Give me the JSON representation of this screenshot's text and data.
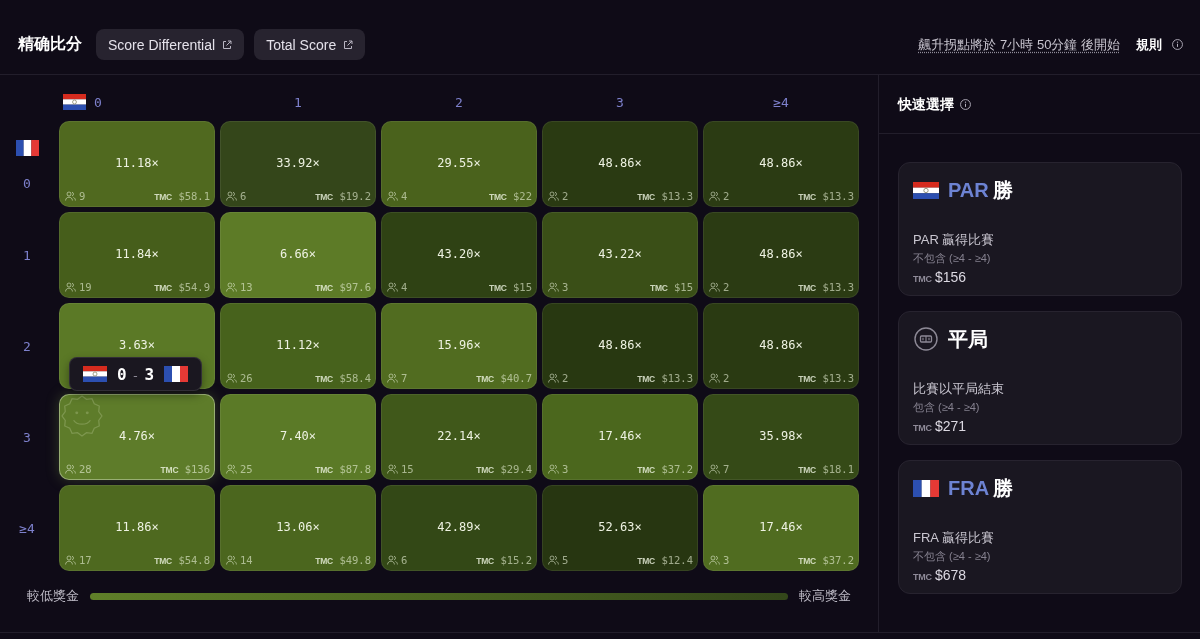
{
  "header": {
    "title": "精确比分",
    "links": [
      {
        "label": "Score Differential"
      },
      {
        "label": "Total Score"
      }
    ],
    "countdown": "飆升拐點將於 7小時 50分鐘 後開始",
    "rules": "規則"
  },
  "grid": {
    "columns": [
      "0",
      "1",
      "2",
      "3",
      "≥4"
    ],
    "rows": [
      {
        "label": "0",
        "cells": [
          {
            "multiplier": "11.18×",
            "players": "9",
            "token": "TMC",
            "amount": "$58.1",
            "color": "#50691f",
            "selected": false
          },
          {
            "multiplier": "33.92×",
            "players": "6",
            "token": "TMC",
            "amount": "$19.2",
            "color": "#34461a",
            "selected": false
          },
          {
            "multiplier": "29.55×",
            "players": "4",
            "token": "TMC",
            "amount": "$22",
            "color": "#4a621c",
            "selected": false
          },
          {
            "multiplier": "48.86×",
            "players": "2",
            "token": "TMC",
            "amount": "$13.3",
            "color": "#2a3a12",
            "selected": false
          },
          {
            "multiplier": "48.86×",
            "players": "2",
            "token": "TMC",
            "amount": "$13.3",
            "color": "#2b3b13",
            "selected": false
          }
        ]
      },
      {
        "label": "1",
        "cells": [
          {
            "multiplier": "11.84×",
            "players": "19",
            "token": "TMC",
            "amount": "$54.9",
            "color": "#465e1b",
            "selected": false
          },
          {
            "multiplier": "6.66×",
            "players": "13",
            "token": "TMC",
            "amount": "$97.6",
            "color": "#5d7b27",
            "selected": false
          },
          {
            "multiplier": "43.20×",
            "players": "4",
            "token": "TMC",
            "amount": "$15",
            "color": "#2f4214",
            "selected": false
          },
          {
            "multiplier": "43.22×",
            "players": "3",
            "token": "TMC",
            "amount": "$15",
            "color": "#3a4f17",
            "selected": false
          },
          {
            "multiplier": "48.86×",
            "players": "2",
            "token": "TMC",
            "amount": "$13.3",
            "color": "#2b3b13",
            "selected": false
          }
        ]
      },
      {
        "label": "2",
        "cells": [
          {
            "multiplier": "3.63×",
            "color": "#5b7926",
            "selected": false
          },
          {
            "multiplier": "11.12×",
            "players": "26",
            "token": "TMC",
            "amount": "$58.4",
            "color": "#47621c",
            "selected": false
          },
          {
            "multiplier": "15.96×",
            "players": "7",
            "token": "TMC",
            "amount": "$40.7",
            "color": "#516c20",
            "selected": false
          },
          {
            "multiplier": "48.86×",
            "players": "2",
            "token": "TMC",
            "amount": "$13.3",
            "color": "#283811",
            "selected": false
          },
          {
            "multiplier": "48.86×",
            "players": "2",
            "token": "TMC",
            "amount": "$13.3",
            "color": "#2a3a12",
            "selected": false
          }
        ]
      },
      {
        "label": "3",
        "cells": [
          {
            "multiplier": "4.76×",
            "players": "28",
            "token": "TMC",
            "amount": "$136",
            "color": "#5e7c2a",
            "selected": true
          },
          {
            "multiplier": "7.40×",
            "players": "25",
            "token": "TMC",
            "amount": "$87.8",
            "color": "#5b7a27",
            "selected": false
          },
          {
            "multiplier": "22.14×",
            "players": "15",
            "token": "TMC",
            "amount": "$29.4",
            "color": "#40581a",
            "selected": false
          },
          {
            "multiplier": "17.46×",
            "players": "3",
            "token": "TMC",
            "amount": "$37.2",
            "color": "#4b671d",
            "selected": false
          },
          {
            "multiplier": "35.98×",
            "players": "7",
            "token": "TMC",
            "amount": "$18.1",
            "color": "#354a17",
            "selected": false
          }
        ]
      },
      {
        "label": "≥4",
        "cells": [
          {
            "multiplier": "11.86×",
            "players": "17",
            "token": "TMC",
            "amount": "$54.8",
            "color": "#4e691f",
            "selected": false
          },
          {
            "multiplier": "13.06×",
            "players": "14",
            "token": "TMC",
            "amount": "$49.8",
            "color": "#4b661e",
            "selected": false
          },
          {
            "multiplier": "42.89×",
            "players": "6",
            "token": "TMC",
            "amount": "$15.2",
            "color": "#334816",
            "selected": false
          },
          {
            "multiplier": "52.63×",
            "players": "5",
            "token": "TMC",
            "amount": "$12.4",
            "color": "#273611",
            "selected": false
          },
          {
            "multiplier": "17.46×",
            "players": "3",
            "token": "TMC",
            "amount": "$37.2",
            "color": "#506c20",
            "selected": false
          }
        ]
      }
    ]
  },
  "tooltip": {
    "home_score": "0",
    "separator": "-",
    "away_score": "3"
  },
  "legend": {
    "low": "較低獎金",
    "high": "較高獎金"
  },
  "quick_pick": {
    "title": "快速選擇",
    "options": [
      {
        "kind": "home",
        "team": "PAR",
        "outcome": "勝",
        "description": "PAR 贏得比賽",
        "note": "不包含 (≥4 - ≥4)",
        "token": "TMC",
        "amount": "$156"
      },
      {
        "kind": "draw",
        "outcome": "平局",
        "description": "比賽以平局結束",
        "note": "包含 (≥4 - ≥4)",
        "token": "TMC",
        "amount": "$271"
      },
      {
        "kind": "away",
        "team": "FRA",
        "outcome": "勝",
        "description": "FRA 贏得比賽",
        "note": "不包含 (≥4 - ≥4)",
        "token": "TMC",
        "amount": "$678"
      }
    ]
  }
}
